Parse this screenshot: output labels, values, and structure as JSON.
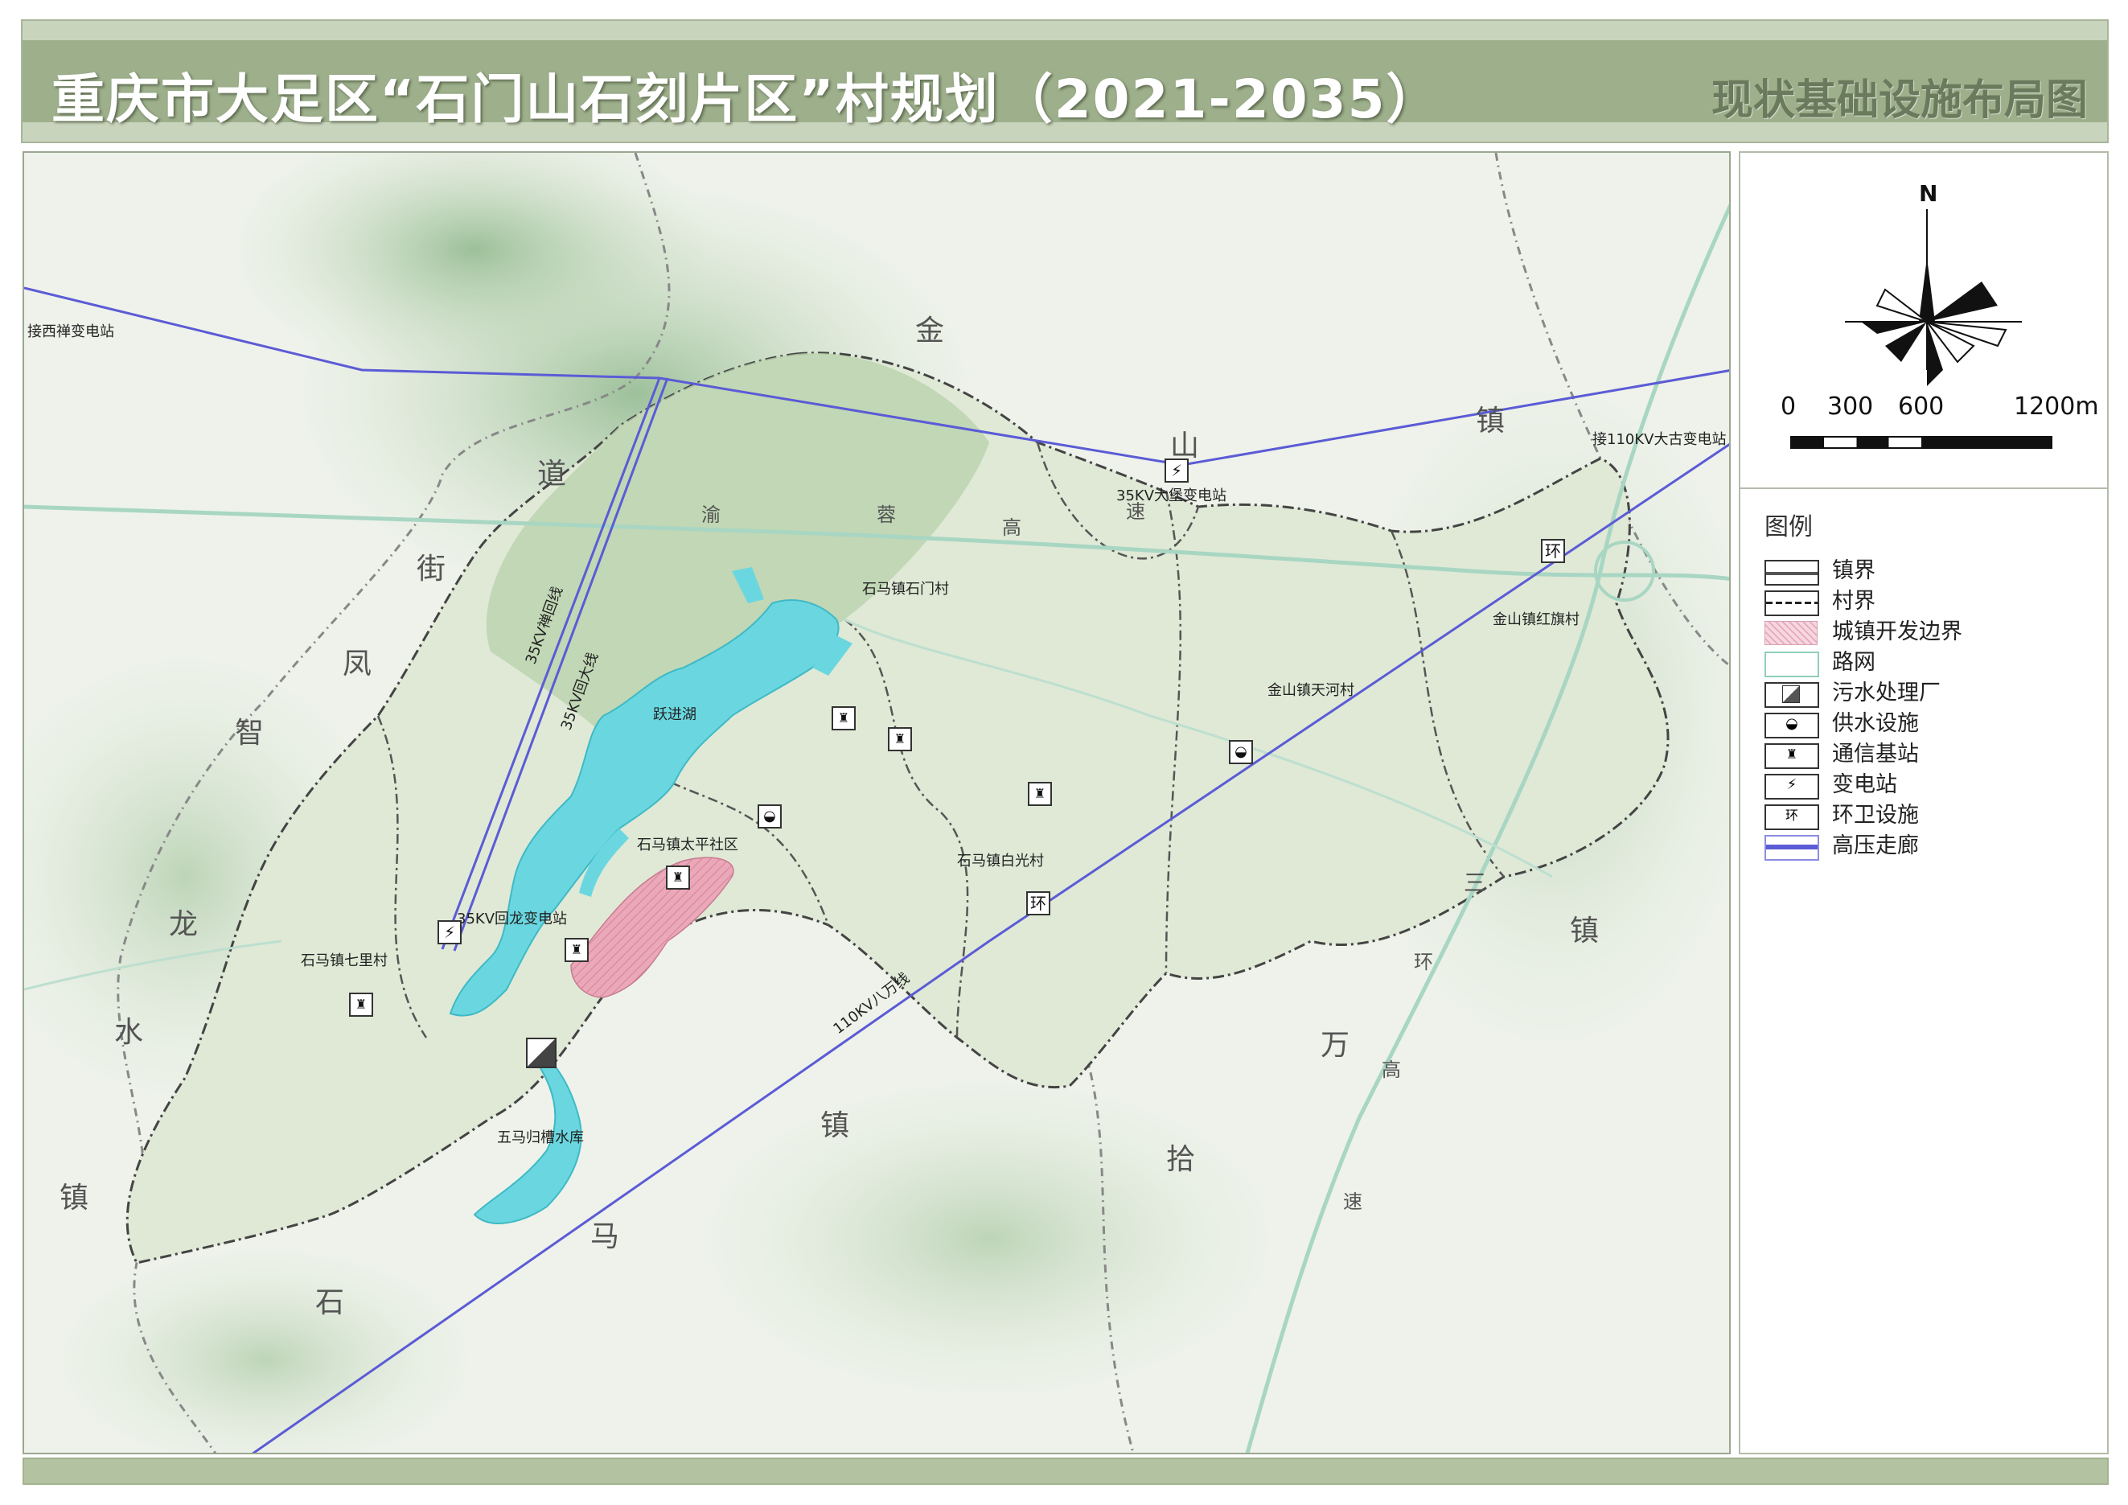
{
  "header": {
    "title": "重庆市大足区“石门山石刻片区”村规划（2021-2035）",
    "subtitle": "现状基础设施布局图"
  },
  "compass": {
    "north_label": "N"
  },
  "scale_bar": {
    "ticks": [
      "0",
      "300",
      "600",
      "1200m"
    ]
  },
  "legend": {
    "title": "图例",
    "items": [
      {
        "key": "town_boundary",
        "label": "镇界"
      },
      {
        "key": "village_boundary",
        "label": "村界"
      },
      {
        "key": "urban_dev_boundary",
        "label": "城镇开发边界"
      },
      {
        "key": "road_network",
        "label": "路网"
      },
      {
        "key": "sewage_plant",
        "label": "污水处理厂"
      },
      {
        "key": "water_supply",
        "label": "供水设施"
      },
      {
        "key": "telecom_station",
        "label": "通信基站"
      },
      {
        "key": "substation",
        "label": "变电站"
      },
      {
        "key": "sanitation",
        "label": "环卫设施"
      },
      {
        "key": "hv_corridor",
        "label": "高压走廊"
      }
    ]
  },
  "map": {
    "town_chars": [
      "金",
      "山",
      "镇",
      "道",
      "街",
      "凤",
      "智",
      "龙",
      "水",
      "镇",
      "石",
      "马",
      "镇",
      "拾",
      "万",
      "镇",
      "三"
    ],
    "highway_chars": [
      "渝",
      "蓉",
      "高",
      "速",
      "环",
      "高",
      "速"
    ],
    "village_labels": [
      "石马镇石门村",
      "金山镇红旗村",
      "金山镇天河村",
      "石马镇太平社区",
      "石马镇白光村",
      "石马镇七里村",
      "跃进湖",
      "五马归槽水库"
    ],
    "station_labels": [
      "接西禅变电站",
      "35KV大堡变电站",
      "接110KV大古变电站",
      "35KV回龙变电站"
    ],
    "line_labels": [
      "35KV禅回线",
      "35KV回大线",
      "110KV八万线"
    ],
    "sanitation_glyph": "环",
    "colors": {
      "hv_line": "#5b5bd6",
      "road": "#a8d6c3",
      "water": "#6ad7e0",
      "urban": "#e8a6b8",
      "boundary": "#555555",
      "header_band": "#9daf8b"
    }
  }
}
